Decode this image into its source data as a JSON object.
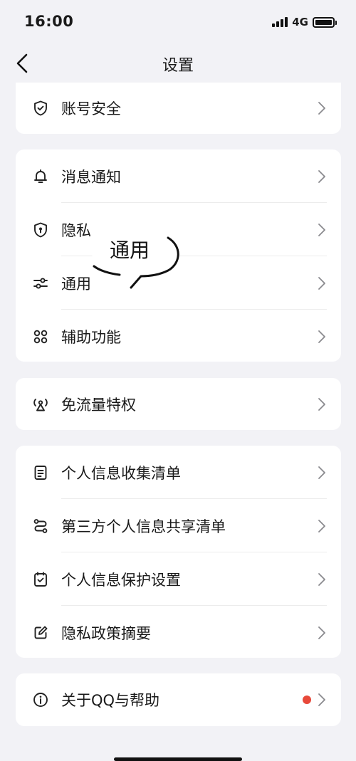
{
  "status_bar": {
    "time": "16:00",
    "network": "4G"
  },
  "nav": {
    "title": "设置"
  },
  "accent": {
    "red_dot": "#e8493a"
  },
  "groups": [
    {
      "items": [
        {
          "label": "账号安全",
          "icon": "shield-check-icon"
        }
      ]
    },
    {
      "items": [
        {
          "label": "消息通知",
          "icon": "bell-icon"
        },
        {
          "label": "隐私",
          "icon": "shield-lock-icon"
        },
        {
          "label": "通用",
          "icon": "sliders-icon"
        },
        {
          "label": "辅助功能",
          "icon": "command-icon"
        }
      ]
    },
    {
      "items": [
        {
          "label": "免流量特权",
          "icon": "antenna-icon"
        }
      ]
    },
    {
      "items": [
        {
          "label": "个人信息收集清单",
          "icon": "document-icon"
        },
        {
          "label": "第三方个人信息共享清单",
          "icon": "share-flow-icon"
        },
        {
          "label": "个人信息保护设置",
          "icon": "checkbox-icon"
        },
        {
          "label": "隐私政策摘要",
          "icon": "edit-icon"
        }
      ]
    },
    {
      "items": [
        {
          "label": "关于QQ与帮助",
          "icon": "info-icon"
        }
      ]
    }
  ],
  "annotation": {
    "text": "通用"
  }
}
